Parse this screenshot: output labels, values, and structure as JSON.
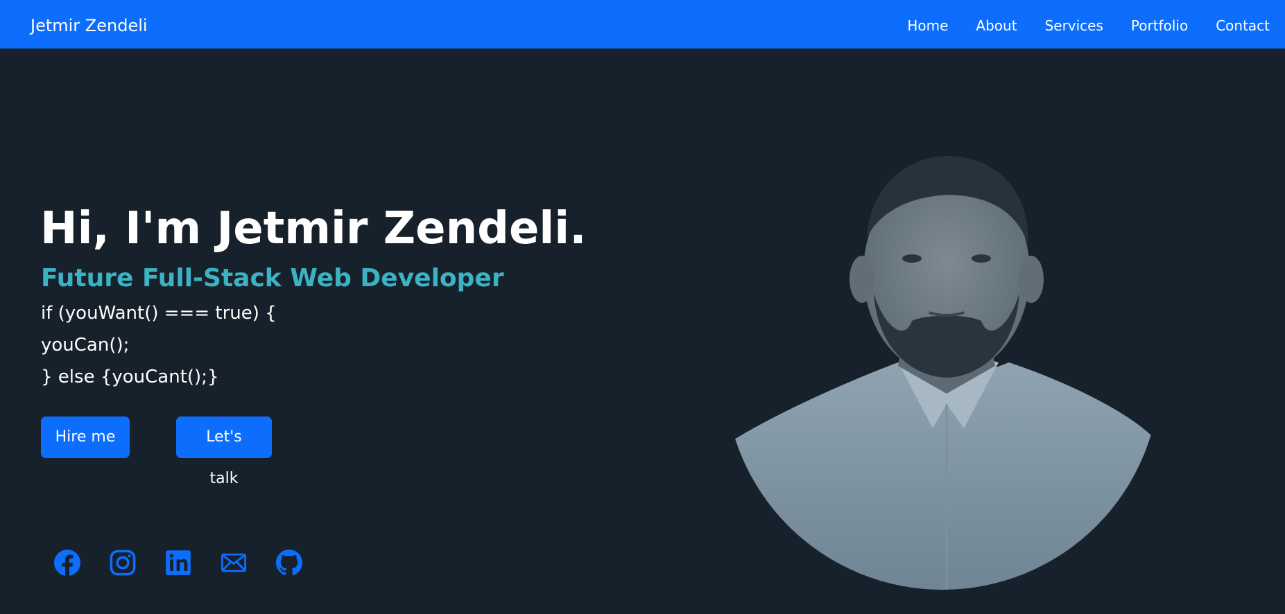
{
  "navbar": {
    "brand": "Jetmir Zendeli",
    "links": [
      "Home",
      "About",
      "Services",
      "Portfolio",
      "Contact"
    ]
  },
  "hero": {
    "title": "Hi, I'm Jetmir Zendeli.",
    "subtitle": "Future Full-Stack Web Developer",
    "code_lines": [
      "if (youWant() === true) {",
      "youCan();",
      "} else {youCant();}"
    ],
    "buttons": {
      "hire": "Hire me",
      "talk": "Let's talk"
    }
  },
  "social": {
    "icons": [
      "facebook-icon",
      "instagram-icon",
      "linkedin-icon",
      "mail-icon",
      "github-icon"
    ]
  },
  "colors": {
    "primary": "#0d6efd",
    "background": "#17212b",
    "accent": "#3bb3c4",
    "text": "#ffffff"
  }
}
